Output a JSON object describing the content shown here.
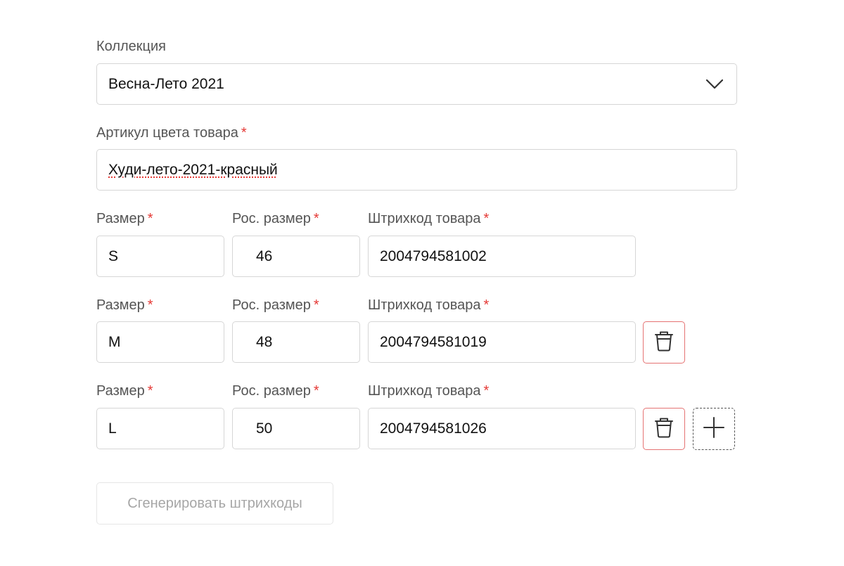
{
  "collection": {
    "label": "Коллекция",
    "value": "Весна-Лето 2021"
  },
  "color_article": {
    "label": "Артикул цвета товара",
    "required_mark": "*",
    "value": "Худи-лето-2021-красный"
  },
  "size_rows": [
    {
      "size_label": "Размер",
      "ru_size_label": "Рос. размер",
      "barcode_label": "Штрихкод товара",
      "required_mark": "*",
      "size": "S",
      "ru_size": "46",
      "barcode": "2004794581002"
    },
    {
      "size_label": "Размер",
      "ru_size_label": "Рос. размер",
      "barcode_label": "Штрихкод товара",
      "required_mark": "*",
      "size": "M",
      "ru_size": "48",
      "barcode": "2004794581019"
    },
    {
      "size_label": "Размер",
      "ru_size_label": "Рос. размер",
      "barcode_label": "Штрихкод товара",
      "required_mark": "*",
      "size": "L",
      "ru_size": "50",
      "barcode": "2004794581026"
    }
  ],
  "generate_button": {
    "label": "Сгенерировать штрихкоды"
  },
  "icons": {
    "select": "chevron-down-icon",
    "delete": "trash-icon",
    "add": "plus-icon"
  },
  "colors": {
    "required": "#e53935",
    "delete_border": "#e57373",
    "border": "#d6d6d6",
    "disabled_text": "#a6a6a6"
  }
}
